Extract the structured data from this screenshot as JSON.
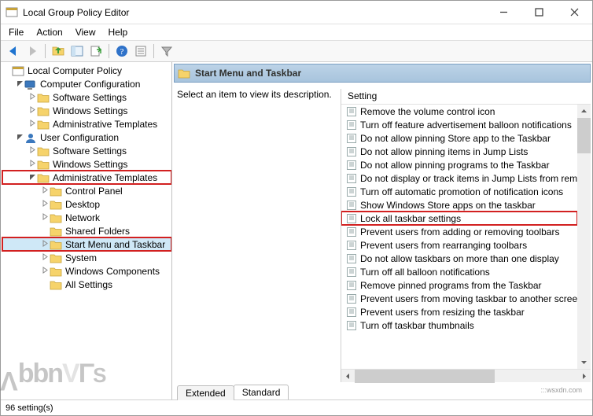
{
  "title": "Local Group Policy Editor",
  "menu": {
    "file": "File",
    "action": "Action",
    "view": "View",
    "help": "Help"
  },
  "header": {
    "title": "Start Menu and Taskbar"
  },
  "description": "Select an item to view its description.",
  "list_header": "Setting",
  "tree": [
    {
      "depth": 0,
      "tw": "",
      "icon": "console-icon",
      "label": "Local Computer Policy"
    },
    {
      "depth": 1,
      "tw": "v",
      "icon": "computer-icon",
      "label": "Computer Configuration"
    },
    {
      "depth": 2,
      "tw": ">",
      "icon": "folder-icon",
      "label": "Software Settings"
    },
    {
      "depth": 2,
      "tw": ">",
      "icon": "folder-icon",
      "label": "Windows Settings"
    },
    {
      "depth": 2,
      "tw": ">",
      "icon": "folder-icon",
      "label": "Administrative Templates"
    },
    {
      "depth": 1,
      "tw": "v",
      "icon": "user-icon",
      "label": "User Configuration"
    },
    {
      "depth": 2,
      "tw": ">",
      "icon": "folder-icon",
      "label": "Software Settings"
    },
    {
      "depth": 2,
      "tw": ">",
      "icon": "folder-icon",
      "label": "Windows Settings"
    },
    {
      "depth": 2,
      "tw": "v",
      "icon": "folder-icon",
      "label": "Administrative Templates",
      "highlight": true
    },
    {
      "depth": 3,
      "tw": ">",
      "icon": "folder-icon",
      "label": "Control Panel"
    },
    {
      "depth": 3,
      "tw": ">",
      "icon": "folder-icon",
      "label": "Desktop"
    },
    {
      "depth": 3,
      "tw": ">",
      "icon": "folder-icon",
      "label": "Network"
    },
    {
      "depth": 3,
      "tw": "",
      "icon": "folder-icon",
      "label": "Shared Folders"
    },
    {
      "depth": 3,
      "tw": ">",
      "icon": "folder-icon",
      "label": "Start Menu and Taskbar",
      "highlight": true,
      "selected": true
    },
    {
      "depth": 3,
      "tw": ">",
      "icon": "folder-icon",
      "label": "System"
    },
    {
      "depth": 3,
      "tw": ">",
      "icon": "folder-icon",
      "label": "Windows Components"
    },
    {
      "depth": 3,
      "tw": "",
      "icon": "folder-icon",
      "label": "All Settings"
    }
  ],
  "settings": [
    {
      "label": "Remove the volume control icon"
    },
    {
      "label": "Turn off feature advertisement balloon notifications"
    },
    {
      "label": "Do not allow pinning Store app to the Taskbar"
    },
    {
      "label": "Do not allow pinning items in Jump Lists"
    },
    {
      "label": "Do not allow pinning programs to the Taskbar"
    },
    {
      "label": "Do not display or track items in Jump Lists from rem"
    },
    {
      "label": "Turn off automatic promotion of notification icons "
    },
    {
      "label": "Show Windows Store apps on the taskbar"
    },
    {
      "label": "Lock all taskbar settings",
      "highlight": true
    },
    {
      "label": "Prevent users from adding or removing toolbars"
    },
    {
      "label": "Prevent users from rearranging toolbars"
    },
    {
      "label": "Do not allow taskbars on more than one display"
    },
    {
      "label": "Turn off all balloon notifications"
    },
    {
      "label": "Remove pinned programs from the Taskbar"
    },
    {
      "label": "Prevent users from moving taskbar to another scree"
    },
    {
      "label": "Prevent users from resizing the taskbar"
    },
    {
      "label": "Turn off taskbar thumbnails"
    }
  ],
  "tabs": {
    "extended": "Extended",
    "standard": "Standard"
  },
  "status": "96 setting(s)",
  "watermark": {
    "main": "APPUALS",
    "site": ":::wsxdn.com"
  }
}
